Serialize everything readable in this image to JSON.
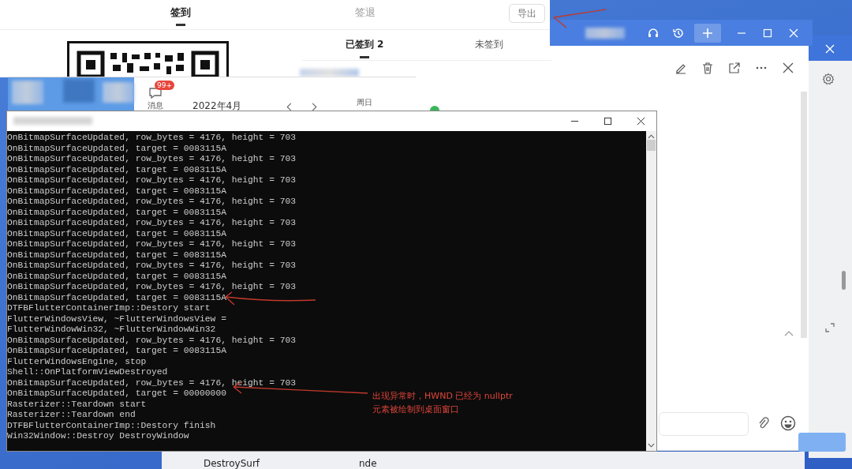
{
  "checkin_panel": {
    "tabs": [
      {
        "label": "签到",
        "selected": true
      },
      {
        "label": "签退",
        "selected": false
      }
    ],
    "export_button": "导出",
    "sub_tabs": [
      {
        "label": "已签到 2",
        "selected": true
      },
      {
        "label": "未签到",
        "selected": false
      }
    ]
  },
  "calendar_window": {
    "messages_badge": "99+",
    "messages_label": "消息",
    "month": "2022年4月",
    "weekday": "周日"
  },
  "console": {
    "lines": [
      "OnBitmapSurfaceUpdated, row_bytes = 4176, height = 703",
      "OnBitmapSurfaceUpdated, target = 0083115A",
      "OnBitmapSurfaceUpdated, row_bytes = 4176, height = 703",
      "OnBitmapSurfaceUpdated, target = 0083115A",
      "OnBitmapSurfaceUpdated, row_bytes = 4176, height = 703",
      "OnBitmapSurfaceUpdated, target = 0083115A",
      "OnBitmapSurfaceUpdated, row_bytes = 4176, height = 703",
      "OnBitmapSurfaceUpdated, target = 0083115A",
      "OnBitmapSurfaceUpdated, row_bytes = 4176, height = 703",
      "OnBitmapSurfaceUpdated, target = 0083115A",
      "OnBitmapSurfaceUpdated, row_bytes = 4176, height = 703",
      "OnBitmapSurfaceUpdated, target = 0083115A",
      "OnBitmapSurfaceUpdated, row_bytes = 4176, height = 703",
      "OnBitmapSurfaceUpdated, target = 0083115A",
      "OnBitmapSurfaceUpdated, row_bytes = 4176, height = 703",
      "OnBitmapSurfaceUpdated, target = 0083115A",
      "DTFBFlutterContainerImp::Destory start",
      "FlutterWindowsView, ~FlutterWindowsView =",
      "FlutterWindowWin32, ~FlutterWindowWin32",
      "OnBitmapSurfaceUpdated, row_bytes = 4176, height = 703",
      "OnBitmapSurfaceUpdated, target = 0083115A",
      "FlutterWindowsEngine, stop",
      "Shell::OnPlatformViewDestroyed",
      "OnBitmapSurfaceUpdated, row_bytes = 4176, height = 703",
      "OnBitmapSurfaceUpdated, target = 00000000",
      "Rasterizer::Teardown start",
      "Rasterizer::Teardown end",
      "DTFBFlutterContainerImp::Destory finish",
      "Win32Window::Destroy DestroyWindow"
    ]
  },
  "annotation": [
    "出现异常时，HWND 已经为 nullptr",
    "元素被绘制到桌面窗口"
  ],
  "background_texts": [
    "DestroySurf",
    "nde"
  ]
}
